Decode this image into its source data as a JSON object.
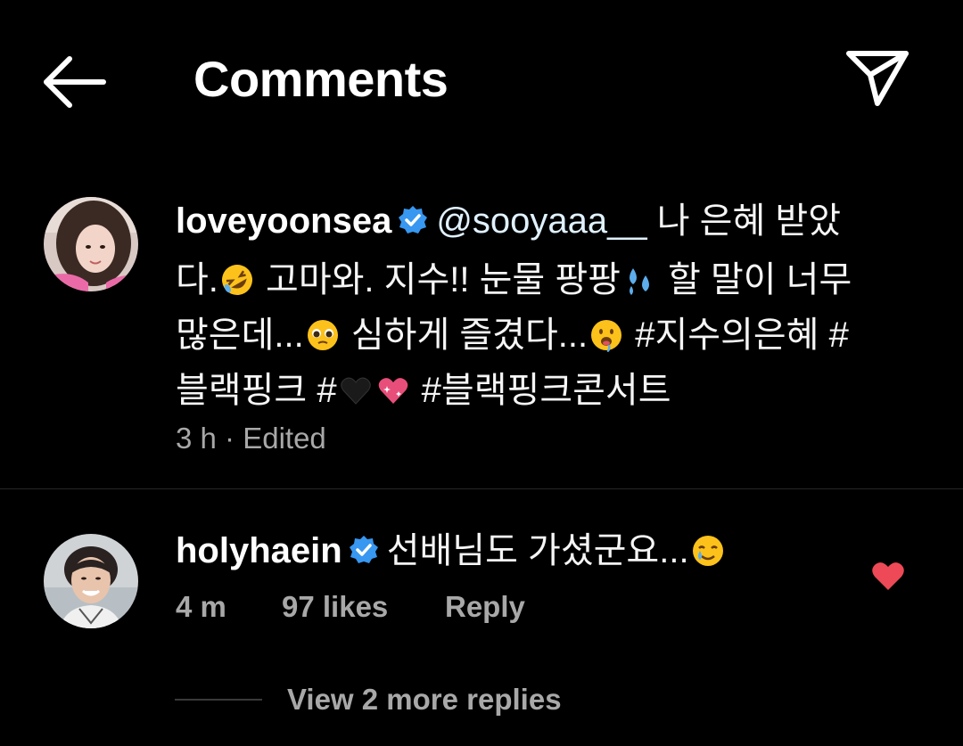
{
  "header": {
    "title": "Comments",
    "back_icon": "arrow-left-icon",
    "share_icon": "paper-plane-icon"
  },
  "caption": {
    "username": "loveyoonsea",
    "verified": true,
    "mention": "@sooyaaa__",
    "segments": [
      " 나 은혜 받았다.",
      " 고마와. 지수!! 눈물 팡팡",
      " 할 말이 너무 많은데...",
      " 심하게 즐겼다...",
      " #지수의은혜 #블랙핑크 #",
      " #블랙핑크콘서트"
    ],
    "emojis": [
      "rolling-laughing-emoji",
      "sweat-droplets-emoji",
      "pleading-face-emoji",
      "drooling-face-emoji",
      "black-heart-emoji",
      "sparkling-heart-emoji"
    ],
    "time": "3 h",
    "separator": "·",
    "edited": "Edited"
  },
  "reply": {
    "username": "holyhaein",
    "verified": true,
    "text": "선배님도 가셨군요...",
    "emoji": "smiling-face-with-tear-emoji",
    "time": "4 m",
    "likes": "97 likes",
    "reply_label": "Reply",
    "liked": true
  },
  "view_replies": "View 2 more replies",
  "colors": {
    "background": "#000000",
    "text": "#ffffff",
    "secondary": "#a8a8a8",
    "verified_blue": "#3897f0",
    "heart_red": "#ed4956",
    "link_blue": "#e0f1ff"
  }
}
